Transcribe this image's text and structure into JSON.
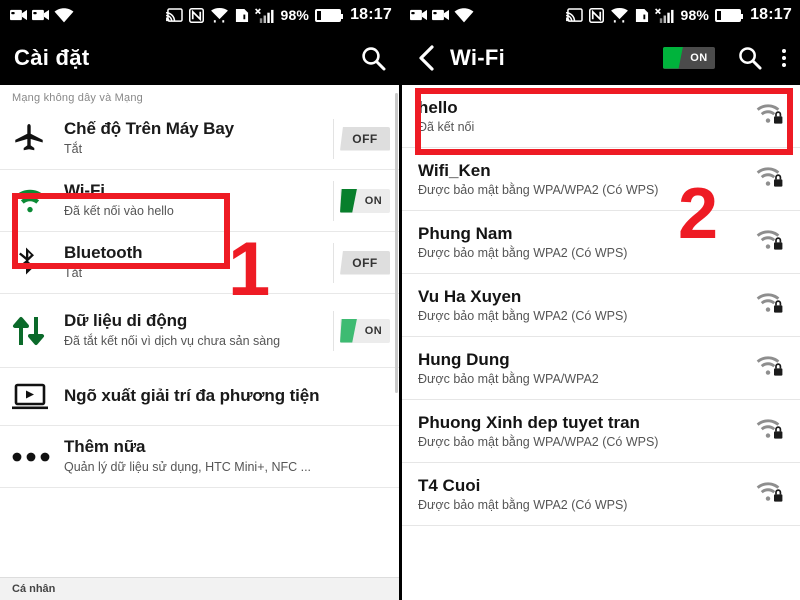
{
  "status_bar": {
    "battery_percent": "98%",
    "time": "18:17",
    "icons": [
      "camera-record-icon",
      "camera-record-icon",
      "wifi-icon",
      "cast-icon",
      "nfc-icon",
      "wifi-alert-icon",
      "sdcard-alert-icon",
      "signal-bars-x-icon",
      "battery-icon"
    ]
  },
  "left_panel": {
    "title": "Cài đặt",
    "search_icon": "search-icon",
    "section_header": "Mạng không dây và Mạng",
    "section_footer": "Cá nhân",
    "rows": [
      {
        "icon": "airplane-icon",
        "title": "Chế độ Trên Máy Bay",
        "sub": "Tắt",
        "toggle": "OFF"
      },
      {
        "icon": "wifi-icon",
        "title": "Wi-Fi",
        "sub": "Đã kết nối vào hello",
        "toggle": "ON"
      },
      {
        "icon": "bluetooth-icon",
        "title": "Bluetooth",
        "sub": "Tắt",
        "toggle": "OFF"
      },
      {
        "icon": "data-arrows-icon",
        "title": "Dữ liệu di động",
        "sub": "Đã tắt kết nối vì dịch vụ chưa sản sàng",
        "toggle": "ON"
      },
      {
        "icon": "media-output-icon",
        "title": "Ngõ xuất giải trí đa phương tiện",
        "sub": "",
        "toggle": ""
      },
      {
        "icon": "more-dots-icon",
        "title": "Thêm nữa",
        "sub": "Quản lý dữ liệu sử dụng, HTC Mini+, NFC ...",
        "toggle": ""
      }
    ]
  },
  "right_panel": {
    "back_icon": "back-chevron-icon",
    "title": "Wi-Fi",
    "toggle_label": "ON",
    "search_icon": "search-icon",
    "overflow_icon": "overflow-menu-icon",
    "networks": [
      {
        "name": "hello",
        "status": "Đã kết nối",
        "secured": true
      },
      {
        "name": "Wifi_Ken",
        "status": "Được bảo mật bằng WPA/WPA2 (Có WPS)",
        "secured": true
      },
      {
        "name": "Phung Nam",
        "status": "Được bảo mật bằng WPA2 (Có WPS)",
        "secured": true
      },
      {
        "name": "Vu Ha Xuyen",
        "status": "Được bảo mật bằng WPA2 (Có WPS)",
        "secured": true
      },
      {
        "name": "Hung Dung",
        "status": "Được bảo mật bằng WPA/WPA2",
        "secured": true
      },
      {
        "name": "Phuong Xinh dep tuyet tran",
        "status": "Được bảo mật bằng WPA/WPA2 (Có WPS)",
        "secured": true
      },
      {
        "name": "T4 Cuoi",
        "status": "Được bảo mật bằng WPA2 (Có WPS)",
        "secured": true
      }
    ]
  },
  "annotations": {
    "marker_one": "1",
    "marker_two": "2",
    "highlight_color": "#ee1b24"
  }
}
